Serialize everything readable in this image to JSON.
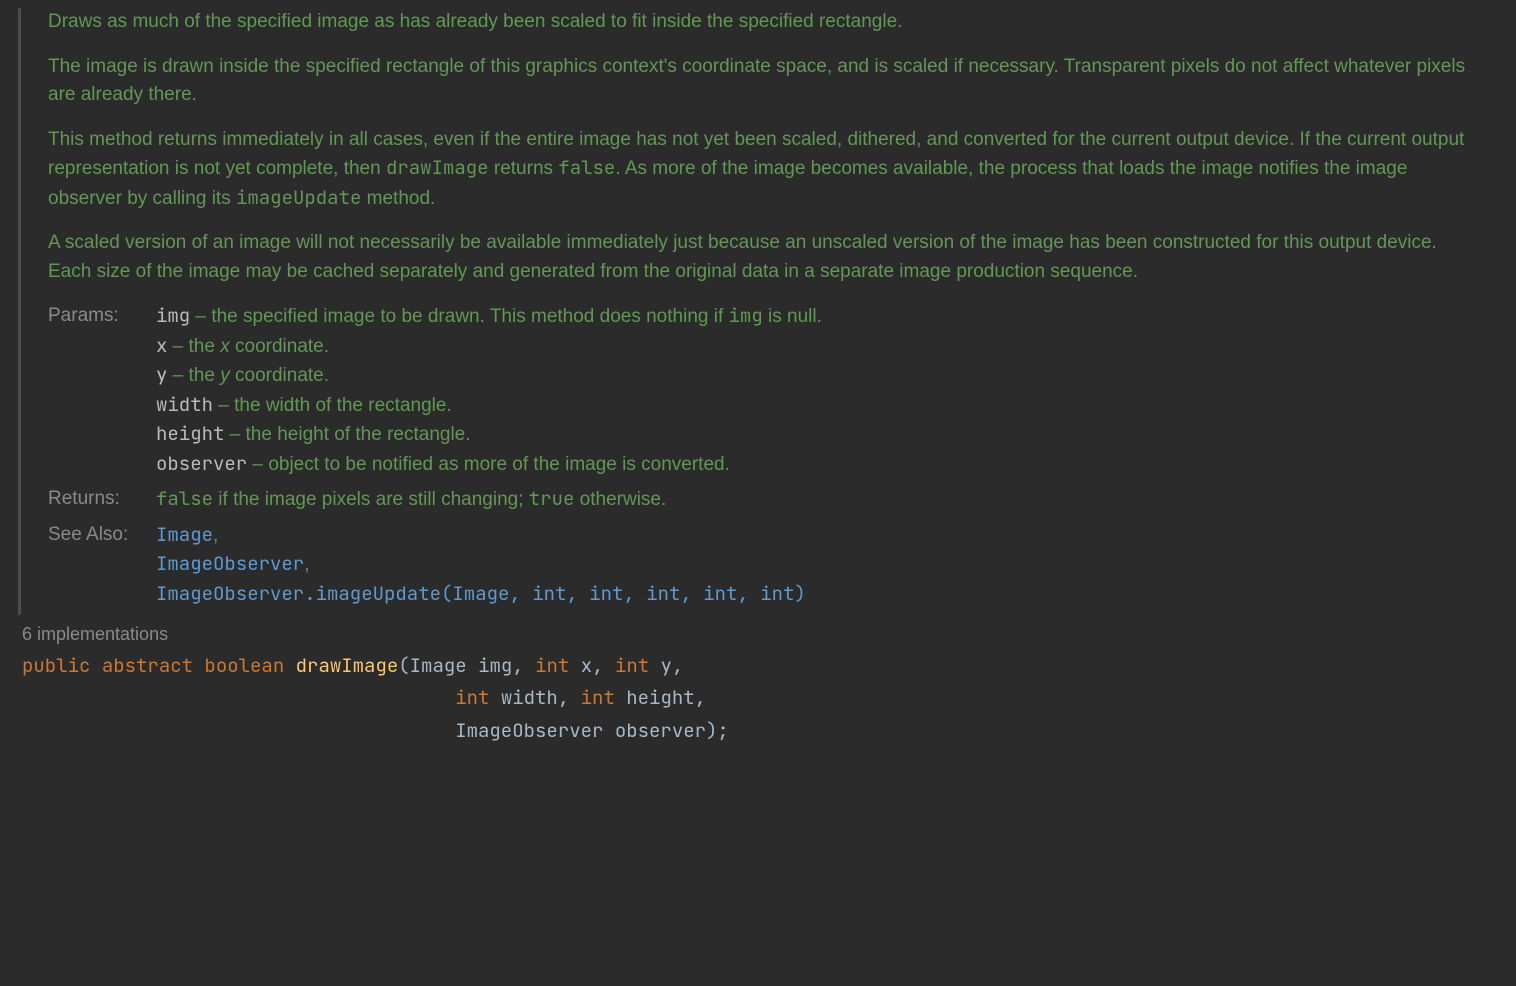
{
  "javadoc": {
    "p1": "Draws as much of the specified image as has already been scaled to fit inside the specified rectangle.",
    "p2": "The image is drawn inside the specified rectangle of this graphics context's coordinate space, and is scaled if necessary. Transparent pixels do not affect whatever pixels are already there.",
    "p3_a": "This method returns immediately in all cases, even if the entire image has not yet been scaled, dithered, and converted for the current output device. If the current output representation is not yet complete, then ",
    "p3_code1": "drawImage",
    "p3_b": " returns ",
    "p3_code2": "false",
    "p3_c": ". As more of the image becomes available, the process that loads the image notifies the image observer by calling its ",
    "p3_code3": "imageUpdate",
    "p3_d": " method.",
    "p4": "A scaled version of an image will not necessarily be available immediately just because an unscaled version of the image has been constructed for this output device. Each size of the image may be cached separately and generated from the original data in a separate image production sequence."
  },
  "labels": {
    "params": "Params:",
    "returns": "Returns:",
    "seealso": "See Also:"
  },
  "params": {
    "img": {
      "name": "img",
      "desc_a": " – the specified image to be drawn. This method does nothing if ",
      "code": "img",
      "desc_b": " is null."
    },
    "x": {
      "name": "x",
      "sep": " – the ",
      "var": "x",
      "desc": " coordinate."
    },
    "y": {
      "name": "y",
      "sep": " – the ",
      "var": "y",
      "desc": " coordinate."
    },
    "w": {
      "name": "width",
      "desc": " – the width of the rectangle."
    },
    "h": {
      "name": "height",
      "desc": " – the height of the rectangle."
    },
    "o": {
      "name": "observer",
      "desc": " – object to be notified as more of the image is converted."
    }
  },
  "returns": {
    "code1": "false",
    "mid": " if the image pixels are still changing; ",
    "code2": "true",
    "end": " otherwise."
  },
  "seealso": {
    "l1": "Image",
    "l2": "ImageObserver",
    "l3": "ImageObserver.imageUpdate(Image, int, int, int, int, int)",
    "comma": ","
  },
  "hint": "6 implementations",
  "sig": {
    "public": "public",
    "abstract": "abstract",
    "boolean": "boolean",
    "method": "drawImage",
    "lp": "(",
    "Image": "Image",
    "img": "img",
    "c": ",",
    "int": "int",
    "x": "x",
    "y": "y",
    "width": "width",
    "height": "height",
    "ImageObserver": "ImageObserver",
    "observer": "observer",
    "rp": ")",
    "semi": ";",
    "sp": " ",
    "indent2": "                                      ",
    "indent3": "                                      "
  }
}
